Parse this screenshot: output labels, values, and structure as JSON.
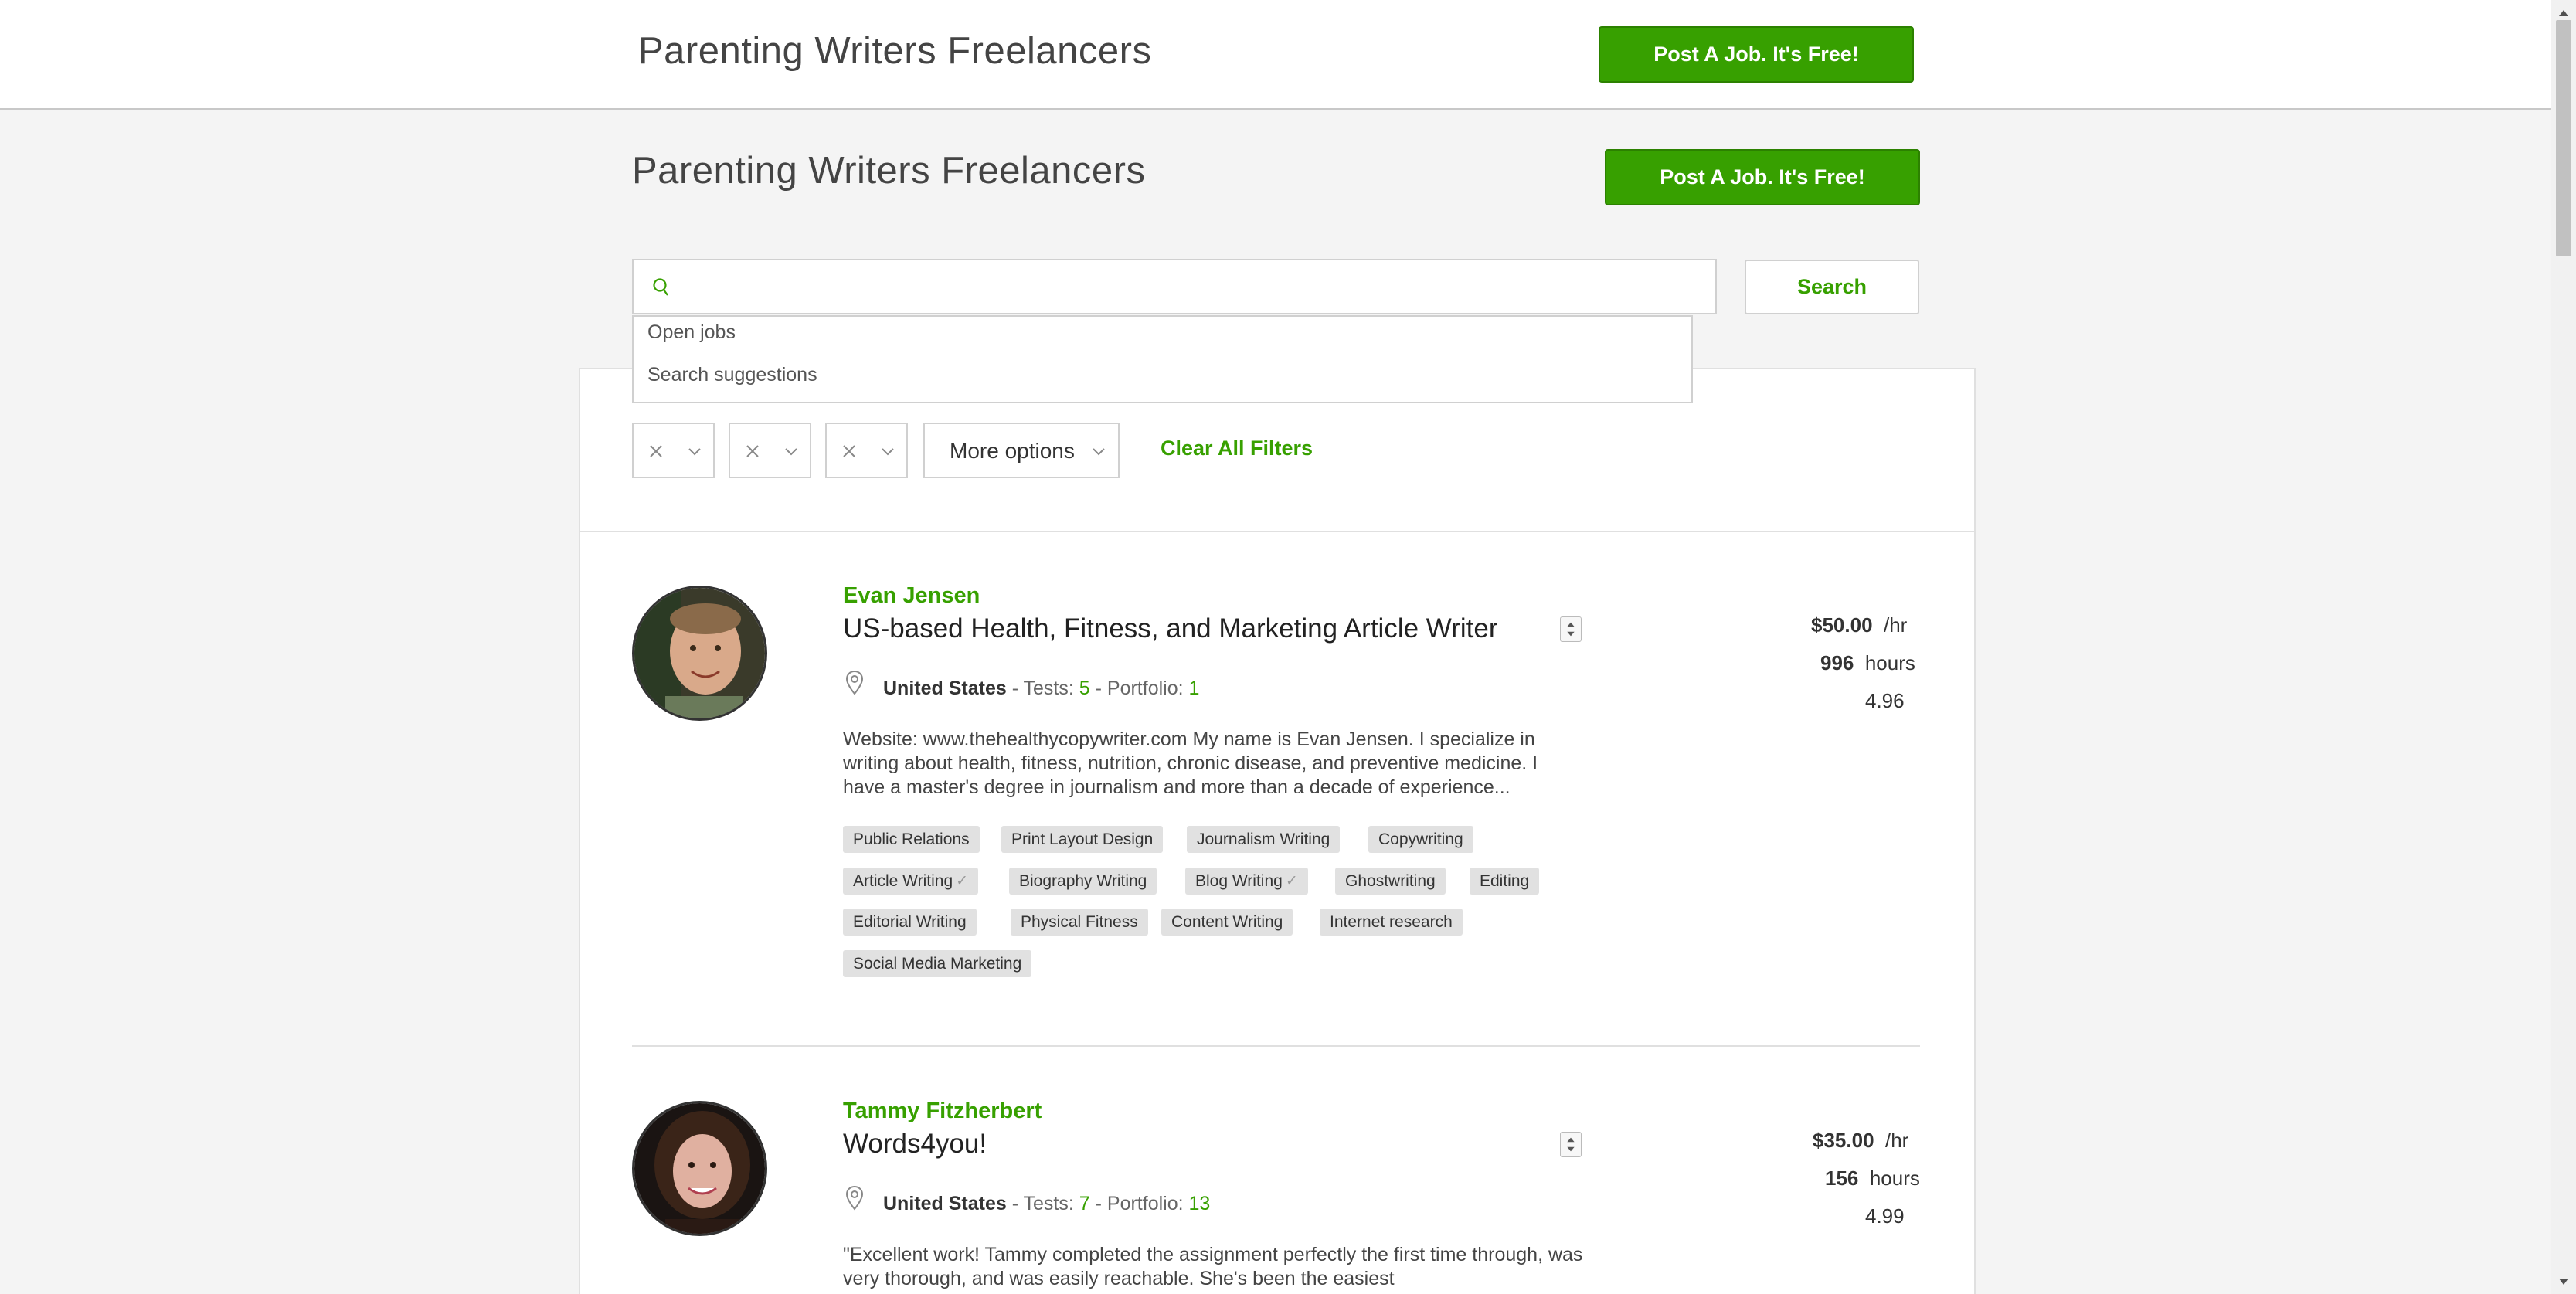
{
  "header": {
    "title": "Parenting Writers Freelancers",
    "post_job_label": "Post A Job. It's Free!"
  },
  "page": {
    "title": "Parenting Writers Freelancers",
    "post_job_label": "Post A Job. It's Free!"
  },
  "search": {
    "value": "",
    "placeholder": "",
    "button_label": "Search",
    "suggestions": [
      "Open jobs",
      "Search suggestions"
    ]
  },
  "filters": {
    "more_options_label": "More options",
    "clear_label": "Clear All Filters"
  },
  "freelancers": [
    {
      "name": "Evan Jensen",
      "title": "US-based Health, Fitness, and Marketing Article Writer",
      "country": "United States",
      "tests_label": "Tests:",
      "tests": "5",
      "portfolio_label": "Portfolio:",
      "portfolio": "1",
      "description": "Website: www.thehealthycopywriter.com My name is Evan Jensen. I specialize in writing about health, fitness, nutrition, chronic disease, and preventive medicine. I have a master's degree in journalism and more than a decade of experience...",
      "tags": [
        {
          "label": "Public Relations",
          "verified": false
        },
        {
          "label": "Print Layout Design",
          "verified": false
        },
        {
          "label": "Journalism Writing",
          "verified": false
        },
        {
          "label": "Copywriting",
          "verified": false
        },
        {
          "label": "Article Writing",
          "verified": true
        },
        {
          "label": "Biography Writing",
          "verified": false
        },
        {
          "label": "Blog Writing",
          "verified": true
        },
        {
          "label": "Ghostwriting",
          "verified": false
        },
        {
          "label": "Editing",
          "verified": false
        },
        {
          "label": "Editorial Writing",
          "verified": false
        },
        {
          "label": "Physical Fitness",
          "verified": false
        },
        {
          "label": "Content Writing",
          "verified": false
        },
        {
          "label": "Internet research",
          "verified": false
        },
        {
          "label": "Social Media Marketing",
          "verified": false
        }
      ],
      "rate": "$50.00",
      "rate_unit": "/hr",
      "hours": "996",
      "hours_unit": "hours",
      "score": "4.96"
    },
    {
      "name": "Tammy Fitzherbert",
      "title": "Words4you!",
      "country": "United States",
      "tests_label": "Tests:",
      "tests": "7",
      "portfolio_label": "Portfolio:",
      "portfolio": "13",
      "description": "\"Excellent work! Tammy completed the assignment perfectly the first time through, was very thorough, and was easily reachable. She's been the easiest",
      "tags": [],
      "rate": "$35.00",
      "rate_unit": "/hr",
      "hours": "156",
      "hours_unit": "hours",
      "score": "4.99"
    }
  ],
  "colors": {
    "accent": "#37a000",
    "background": "#f4f4f4"
  }
}
